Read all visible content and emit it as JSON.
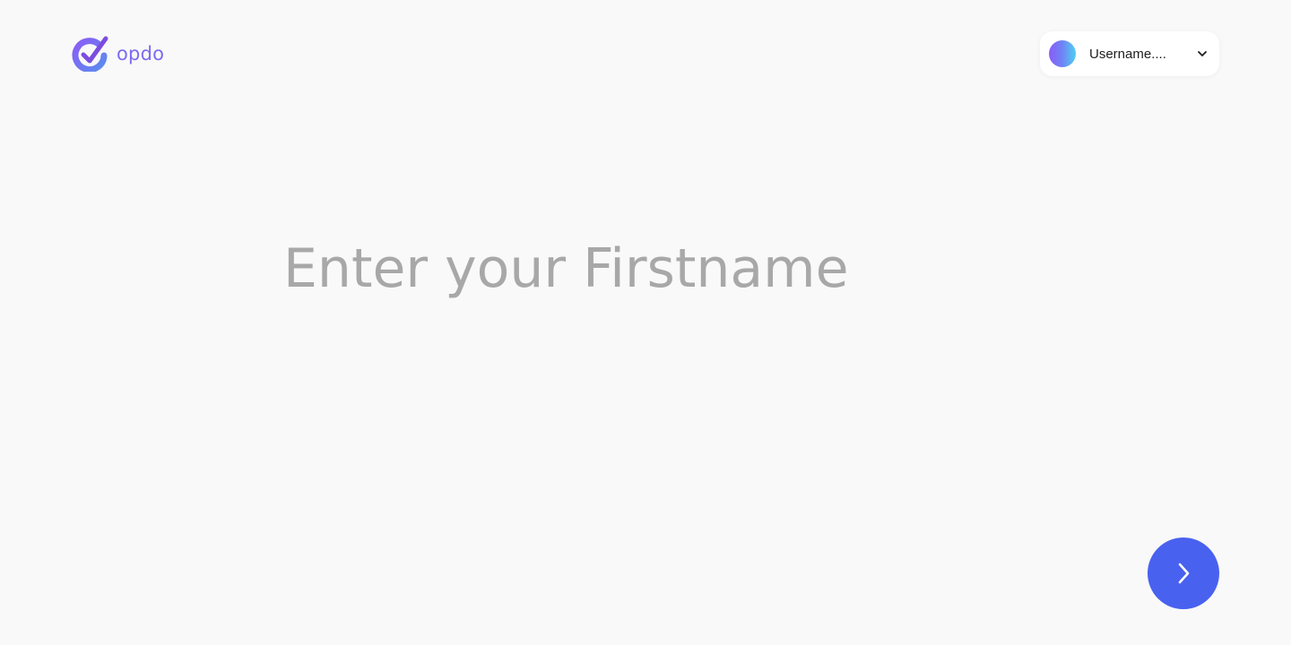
{
  "logo": {
    "text": "opdo",
    "icon": "check-circle-logo-icon",
    "colors": {
      "ring_start": "#8b5cf6",
      "ring_end": "#5b8def",
      "check": "#7c4ddf",
      "text": "#7b6cf0"
    }
  },
  "user_menu": {
    "username": "Username....",
    "avatar_icon": "avatar-gradient",
    "dropdown_icon": "chevron-down-icon"
  },
  "form": {
    "firstname_placeholder": "Enter your Firstname",
    "firstname_value": ""
  },
  "actions": {
    "next_icon": "chevron-right-icon",
    "next_color": "#4961ef"
  },
  "colors": {
    "background": "#f9f9f9",
    "accent": "#4961ef",
    "placeholder": "#a8a8a8"
  }
}
